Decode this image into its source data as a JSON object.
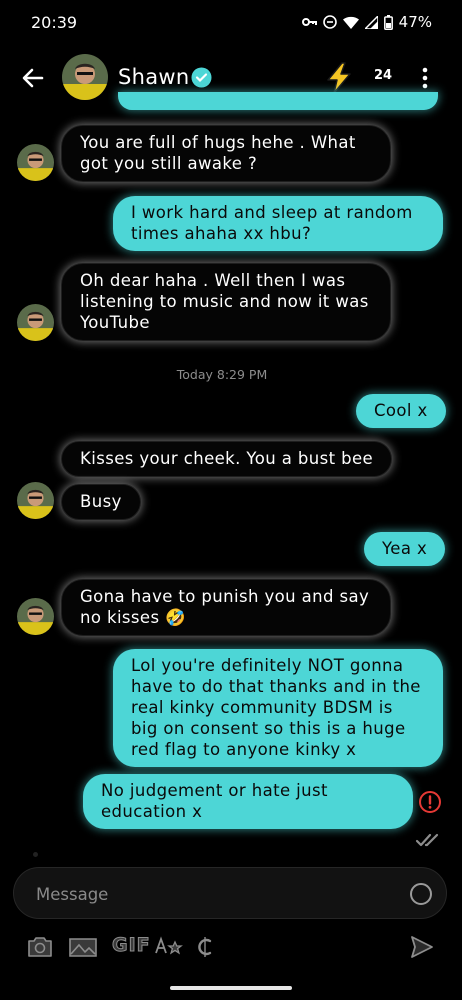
{
  "status": {
    "time": "20:39",
    "battery": "47%"
  },
  "header": {
    "name": "Shawn",
    "count": "24"
  },
  "messages": [
    {
      "dir": "in",
      "text": "You are full of hugs hehe . What got you still awake ?"
    },
    {
      "dir": "out",
      "text": "I work hard and sleep at random times ahaha xx hbu?"
    },
    {
      "dir": "in",
      "text": "Oh dear haha . Well then I was listening to music and now it was YouTube"
    },
    {
      "dir": "out",
      "text": "Cool x"
    },
    {
      "dir": "in",
      "text": "Kisses your cheek.  You a bust bee"
    },
    {
      "dir": "in",
      "text": "Busy"
    },
    {
      "dir": "out",
      "text": "Yea x"
    },
    {
      "dir": "in",
      "text": "Gona have to punish you and say no kisses 🤣"
    },
    {
      "dir": "out",
      "text": "Lol you're definitely NOT gonna have to do that thanks and in the real kinky community BDSM is big on consent so this is a huge red flag to anyone kinky x"
    },
    {
      "dir": "out",
      "text": "No judgement or hate just education x"
    }
  ],
  "timestamp": "Today 8:29 PM",
  "composer": {
    "placeholder": "Message"
  },
  "toolbar": {
    "gif_label": "GIF"
  },
  "colors": {
    "accent": "#4dd6d6",
    "background": "#000000",
    "error": "#e53935"
  }
}
